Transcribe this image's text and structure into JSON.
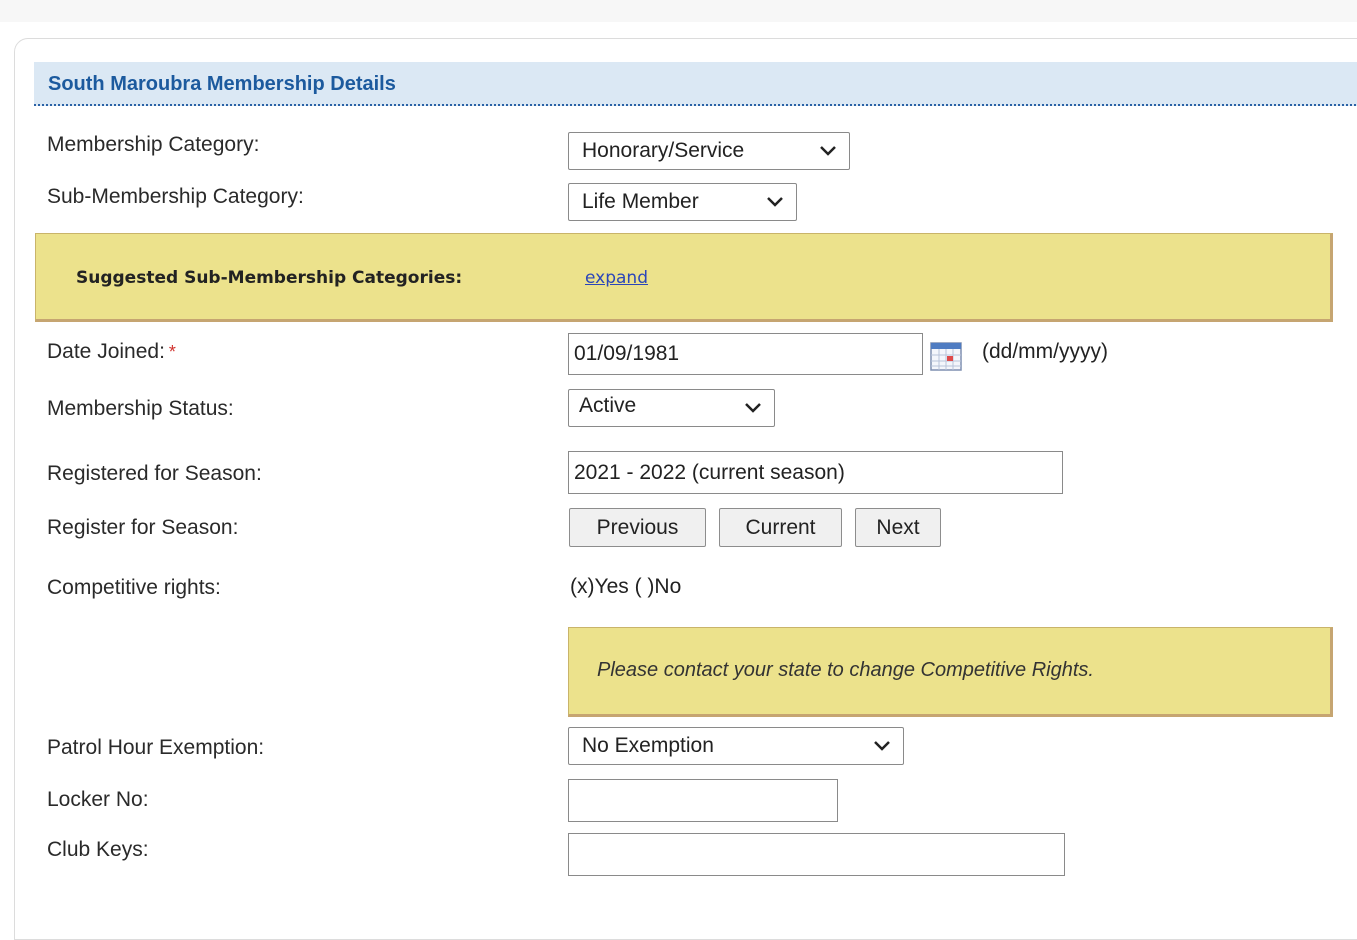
{
  "section": {
    "title": "South Maroubra Membership Details"
  },
  "fields": {
    "membership_category": {
      "label": "Membership Category:",
      "value": "Honorary/Service"
    },
    "sub_membership_category": {
      "label": "Sub-Membership Category:",
      "value": "Life Member"
    },
    "suggested": {
      "label": "Suggested Sub-Membership Categories:",
      "link": "expand"
    },
    "date_joined": {
      "label": "Date Joined:",
      "required_mark": "*",
      "value": "01/09/1981",
      "format": "(dd/mm/yyyy)"
    },
    "membership_status": {
      "label": "Membership Status:",
      "value": "Active"
    },
    "registered_for_season": {
      "label": "Registered for Season:",
      "value": "2021 - 2022 (current season)"
    },
    "register_for_season": {
      "label": "Register for Season:",
      "buttons": [
        "Previous",
        "Current",
        "Next"
      ]
    },
    "competitive_rights": {
      "label": "Competitive rights:",
      "value": "(x)Yes ( )No",
      "notice": "Please contact your state to change Competitive Rights."
    },
    "patrol_hour_exemption": {
      "label": "Patrol Hour Exemption:",
      "value": "No Exemption"
    },
    "locker_no": {
      "label": "Locker No:",
      "value": ""
    },
    "club_keys": {
      "label": "Club Keys:",
      "value": ""
    }
  },
  "icons": {
    "calendar": "calendar-icon",
    "dropdown": "chevron-down-icon"
  },
  "colors": {
    "header_bg": "#dbe8f4",
    "header_text": "#1c5a9e",
    "notice_bg": "#ece28c",
    "link": "#2b46b9",
    "required": "#d0312d"
  }
}
